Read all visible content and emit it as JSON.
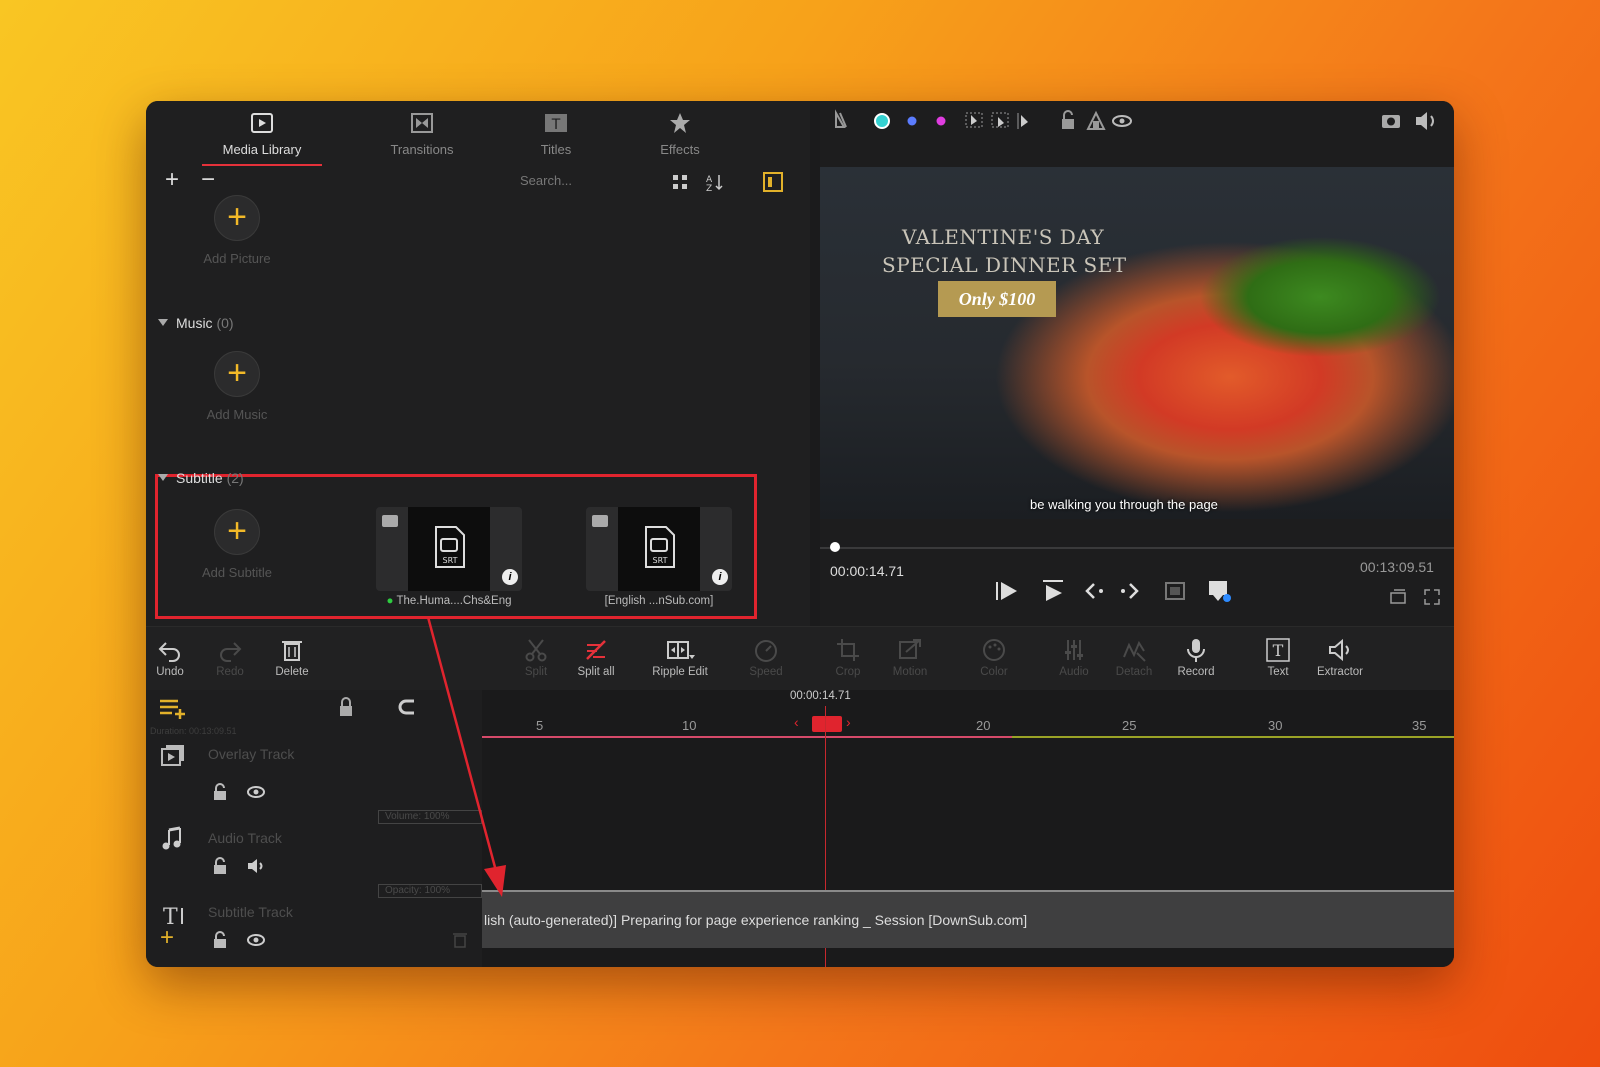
{
  "tabs": [
    {
      "label": "Media Library",
      "active": true
    },
    {
      "label": "Transitions",
      "active": false
    },
    {
      "label": "Titles",
      "active": false
    },
    {
      "label": "Effects",
      "active": false
    }
  ],
  "media": {
    "search_placeholder": "Search...",
    "add_picture_label": "Add Picture",
    "music_label": "Music",
    "music_count": "(0)",
    "add_music_label": "Add Music",
    "subtitle_label": "Subtitle",
    "subtitle_count": "(2)",
    "add_subtitle_label": "Add Subtitle",
    "subtitle_files": [
      {
        "name": "The.Huma....Chs&Eng",
        "badge": "SRT"
      },
      {
        "name": "[English ...nSub.com]",
        "badge": "SRT"
      }
    ]
  },
  "preview": {
    "title_line1": "VALENTINE'S DAY",
    "title_line2": "SPECIAL DINNER SET",
    "price": "Only $100",
    "subtitle_overlay": "be walking you through the page",
    "current_time": "00:00:14.71",
    "total_time": "00:13:09.51"
  },
  "edit_tools": [
    {
      "label": "Undo",
      "enabled": true
    },
    {
      "label": "Redo",
      "enabled": false
    },
    {
      "label": "Delete",
      "enabled": true
    },
    {
      "label": "Split",
      "enabled": false
    },
    {
      "label": "Split all",
      "enabled": true
    },
    {
      "label": "Ripple Edit",
      "enabled": true
    },
    {
      "label": "Speed",
      "enabled": false
    },
    {
      "label": "Crop",
      "enabled": false
    },
    {
      "label": "Motion",
      "enabled": false
    },
    {
      "label": "Color",
      "enabled": false
    },
    {
      "label": "Audio",
      "enabled": false
    },
    {
      "label": "Detach",
      "enabled": false
    },
    {
      "label": "Record",
      "enabled": true
    },
    {
      "label": "Text",
      "enabled": true
    },
    {
      "label": "Extractor",
      "enabled": true
    }
  ],
  "timeline": {
    "duration_label": "Duration: 00:13:09.51",
    "playhead_time": "00:00:14.71",
    "ruler_ticks": [
      "5",
      "10",
      "20",
      "25",
      "30",
      "35"
    ],
    "tracks": [
      {
        "name": "Overlay Track"
      },
      {
        "name": "Audio Track",
        "badge": "Volume: 100%"
      },
      {
        "name": "Subtitle Track",
        "badge": "Opacity: 100%"
      }
    ],
    "subtitle_clip_text": "lish (auto-generated)] Preparing for page experience ranking _ Session [DownSub.com]"
  },
  "colors": {
    "accent_red": "#e0242e",
    "add_yellow": "#f2b928",
    "bg_panel": "#1f1f20"
  }
}
